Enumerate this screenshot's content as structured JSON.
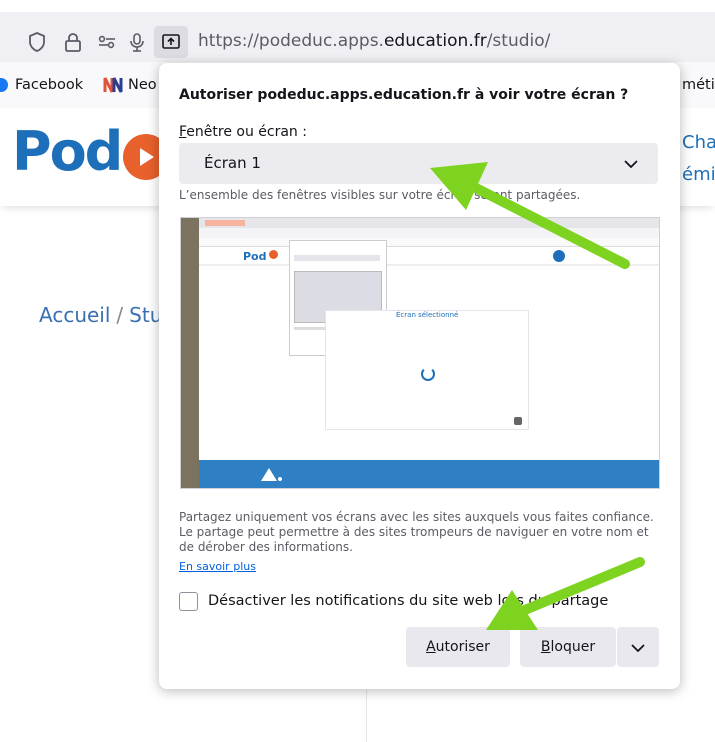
{
  "browser": {
    "url_prefix": "https://podeduc.apps.",
    "url_host": "education.fr",
    "url_path": "/studio/",
    "bookmarks": [
      "Facebook",
      "Neo",
      "méti"
    ]
  },
  "page": {
    "logo": "Pod",
    "header_links": [
      "Cha",
      "émi"
    ],
    "breadcrumb": [
      "Accueil",
      "Stu"
    ]
  },
  "dialog": {
    "title": "Autoriser podeduc.apps.education.fr à voir votre écran ?",
    "select_label_prefix": "F",
    "select_label_rest": "enêtre ou écran :",
    "select_value": "Écran 1",
    "select_description": "L’ensemble des fenêtres visibles sur votre écran seront partagées.",
    "warning": "Partagez uniquement vos écrans avec les sites auxquels vous faites confiance. Le partage peut permettre à des sites trompeurs de naviguer en votre nom et de dérober des informations.",
    "learn_more": "En savoir plus",
    "notifications_label": "Désactiver les notifications du site web lors du partage",
    "notifications_checked": false,
    "allow_prefix": "A",
    "allow_rest": "utoriser",
    "block_prefix": "B",
    "block_rest": "loquer"
  },
  "preview": {
    "selected_screen_text": "Écran sélectionné"
  },
  "colors": {
    "accent_arrow": "#7ed321",
    "brand_blue": "#1c6fb8",
    "brand_orange": "#e8612c"
  }
}
